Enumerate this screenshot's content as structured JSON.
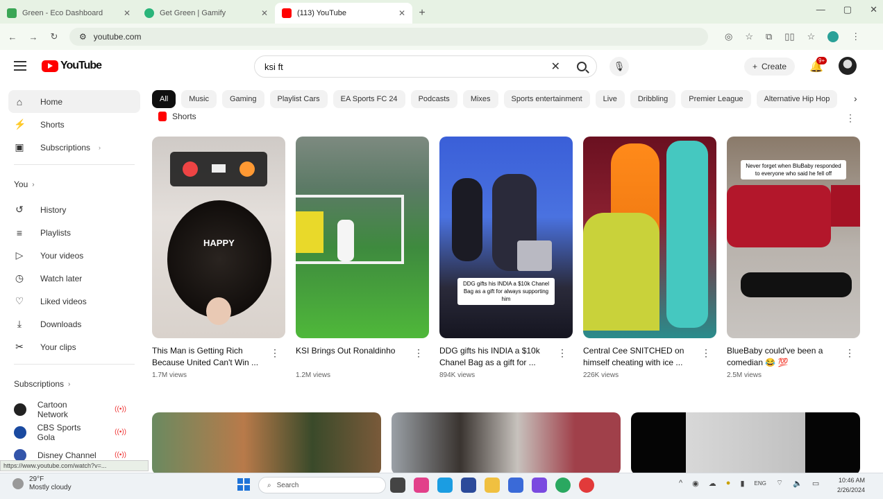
{
  "browser": {
    "tabs": [
      {
        "title": "Green - Eco Dashboard",
        "color": "#3aa655"
      },
      {
        "title": "Get Green | Gamify",
        "color": "#2ab57a"
      },
      {
        "title": "(113) YouTube",
        "color": "#ff0000"
      }
    ],
    "new_tab": "+",
    "url": "youtube.com"
  },
  "youtube": {
    "logo_text": "YouTube",
    "search_query": "ksi ft",
    "create_label": "Create",
    "notifications_count": "9+"
  },
  "sidebar": {
    "main": [
      {
        "label": "Home",
        "icon": "home-icon",
        "glyph": "⌂"
      },
      {
        "label": "Shorts",
        "icon": "shorts-icon",
        "glyph": "⚡"
      },
      {
        "label": "Subscriptions",
        "icon": "subscriptions-icon",
        "glyph": "▣"
      }
    ],
    "you_heading": "You",
    "you": [
      {
        "label": "History",
        "icon": "history-icon",
        "glyph": "↺"
      },
      {
        "label": "Playlists",
        "icon": "playlists-icon",
        "glyph": "≡"
      },
      {
        "label": "Your videos",
        "icon": "your-videos-icon",
        "glyph": "▷"
      },
      {
        "label": "Watch later",
        "icon": "watch-later-icon",
        "glyph": "◷"
      },
      {
        "label": "Liked videos",
        "icon": "liked-icon",
        "glyph": "👍"
      },
      {
        "label": "Downloads",
        "icon": "downloads-icon",
        "glyph": "⤓"
      },
      {
        "label": "Your clips",
        "icon": "clips-icon",
        "glyph": "✂"
      }
    ],
    "subs_heading": "Subscriptions",
    "subs": [
      {
        "label": "Cartoon Network",
        "color": "#222222"
      },
      {
        "label": "CBS Sports Gola",
        "color": "#1a4aa0"
      },
      {
        "label": "Disney Channel",
        "color": "#3355aa"
      }
    ]
  },
  "chips": [
    "All",
    "Music",
    "Gaming",
    "Playlist Cars",
    "EA Sports FC 24",
    "Podcasts",
    "Mixes",
    "Sports entertainment",
    "Live",
    "Dribbling",
    "Premier League",
    "Alternative Hip Hop"
  ],
  "shorts": {
    "heading": "Shorts",
    "items": [
      {
        "title": "This Man is Getting Rich Because United Can't Win ...",
        "views": "1.7M views",
        "overlay": "HAPPY"
      },
      {
        "title": "KSI Brings Out Ronaldinho",
        "views": "1.2M views"
      },
      {
        "title": "DDG gifts his INDIA a $10k Chanel Bag as a gift for ...",
        "views": "894K views",
        "caption": "DDG gifts his INDIA a $10k Chanel Bag as a gift for always supporting him"
      },
      {
        "title": "Central Cee SNITCHED on himself cheating with ice ...",
        "views": "226K views"
      },
      {
        "title": "BlueBaby could've been a comedian 😂 💯",
        "views": "2.5M views",
        "caption": "Never forget when BluBaby responded to everyone who said he fell off"
      }
    ]
  },
  "status_url": "https://www.youtube.com/watch?v=...",
  "taskbar": {
    "weather_temp": "29°F",
    "weather_desc": "Mostly cloudy",
    "search_placeholder": "Search",
    "time": "10:46 AM",
    "date": "2/26/2024"
  }
}
